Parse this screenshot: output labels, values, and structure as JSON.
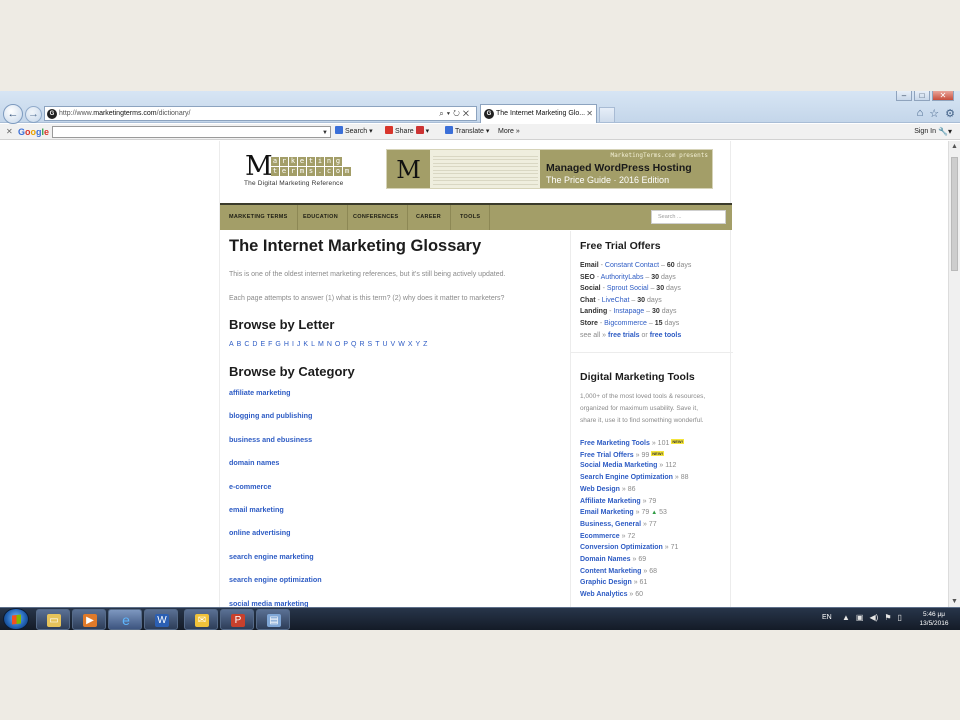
{
  "browser": {
    "address_prefix": "http://www.",
    "address_host": "marketingterms.com",
    "address_path": "/dictionary/",
    "tab_title": "The Internet Marketing Glo...",
    "favicon_glyph": "G"
  },
  "google_toolbar": {
    "logo_parts": [
      "G",
      "o",
      "o",
      "g",
      "l",
      "e"
    ],
    "search_label": "Search",
    "share_label": "Share",
    "translate_label": "Translate",
    "more_label": "More",
    "sign_in_label": "Sign In"
  },
  "site": {
    "logo_m": "M",
    "logo_row1": [
      "a",
      "r",
      "k",
      "e",
      "t",
      "i",
      "n",
      "g"
    ],
    "logo_row2": [
      "t",
      "e",
      "r",
      "m",
      "s",
      ".",
      "c",
      "o",
      "m"
    ],
    "logo_tagline": "The Digital Marketing Reference",
    "ad": {
      "m": "M",
      "presents": "MarketingTerms.com presents",
      "headline": "Managed WordPress Hosting",
      "subline": "The Price Guide · 2016 Edition"
    },
    "nav": [
      "MARKETING TERMS",
      "EDUCATION",
      "CONFERENCES",
      "CAREER",
      "TOOLS"
    ],
    "search_placeholder": "Search ..."
  },
  "main": {
    "title": "The Internet Marketing Glossary",
    "intro1": "This is one of the oldest internet marketing references, but it's still being actively updated.",
    "intro2": "Each page attempts to answer (1) what is this term? (2) why does it matter to marketers?",
    "browse_letter_heading": "Browse by Letter",
    "letters": [
      "A",
      "B",
      "C",
      "D",
      "E",
      "F",
      "G",
      "H",
      "I",
      "J",
      "K",
      "L",
      "M",
      "N",
      "O",
      "P",
      "Q",
      "R",
      "S",
      "T",
      "U",
      "V",
      "W",
      "X",
      "Y",
      "Z"
    ],
    "browse_category_heading": "Browse by Category",
    "categories": [
      "affiliate marketing",
      "blogging and publishing",
      "business and ebusiness",
      "domain names",
      "e-commerce",
      "email marketing",
      "online advertising",
      "search engine marketing",
      "search engine optimization",
      "social media marketing"
    ]
  },
  "sidebar": {
    "free_trial_heading": "Free Trial Offers",
    "offers": [
      {
        "label": "Email",
        "vendor": "Constant Contact",
        "days": "60",
        "unit": "days"
      },
      {
        "label": "SEO",
        "vendor": "AuthorityLabs",
        "days": "30",
        "unit": "days"
      },
      {
        "label": "Social",
        "vendor": "Sprout Social",
        "days": "30",
        "unit": "days"
      },
      {
        "label": "Chat",
        "vendor": "LiveChat",
        "days": "30",
        "unit": "days"
      },
      {
        "label": "Landing",
        "vendor": "Instapage",
        "days": "30",
        "unit": "days"
      },
      {
        "label": "Store",
        "vendor": "Bigcommerce",
        "days": "15",
        "unit": "days"
      }
    ],
    "see_all": "see all »",
    "free_trials": "free trials",
    "or": "or",
    "free_tools": "free tools",
    "tools_heading": "Digital Marketing Tools",
    "tools_desc": [
      "1,000+ of the most loved tools & resources,",
      "organized for maximum usability. Save it,",
      "share it, use it to find something wonderful."
    ],
    "tools": [
      {
        "name": "Free Marketing Tools",
        "count": "» 101",
        "badge": "NEW!",
        "up": ""
      },
      {
        "name": "Free Trial Offers",
        "count": "» 99",
        "badge": "NEW!",
        "up": ""
      },
      {
        "name": "Social Media Marketing",
        "count": "» 112",
        "badge": "",
        "up": ""
      },
      {
        "name": "Search Engine Optimization",
        "count": "» 88",
        "badge": "",
        "up": ""
      },
      {
        "name": "Web Design",
        "count": "» 86",
        "badge": "",
        "up": ""
      },
      {
        "name": "Affiliate Marketing",
        "count": "» 79",
        "badge": "",
        "up": ""
      },
      {
        "name": "Email Marketing",
        "count": "» 79",
        "badge": "",
        "up": "53"
      },
      {
        "name": "Business, General",
        "count": "» 77",
        "badge": "",
        "up": ""
      },
      {
        "name": "Ecommerce",
        "count": "» 72",
        "badge": "",
        "up": ""
      },
      {
        "name": "Conversion Optimization",
        "count": "» 71",
        "badge": "",
        "up": ""
      },
      {
        "name": "Domain Names",
        "count": "» 69",
        "badge": "",
        "up": ""
      },
      {
        "name": "Content Marketing",
        "count": "» 68",
        "badge": "",
        "up": ""
      },
      {
        "name": "Graphic Design",
        "count": "» 61",
        "badge": "",
        "up": ""
      },
      {
        "name": "Web Analytics",
        "count": "» 60",
        "badge": "",
        "up": ""
      }
    ]
  },
  "taskbar": {
    "lang": "EN",
    "time": "5:46 μμ",
    "date": "13/5/2016"
  }
}
